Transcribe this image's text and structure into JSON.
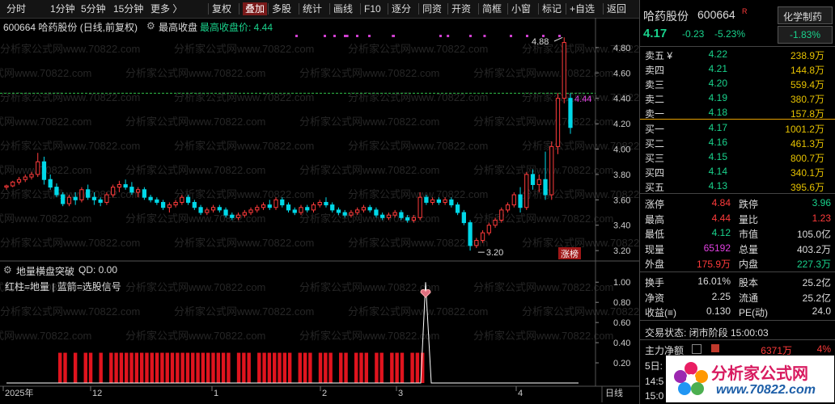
{
  "toolbar": {
    "items": [
      "分时",
      "1分钟",
      "5分钟",
      "15分钟",
      "更多 〉",
      "复权",
      "叠加",
      "多股",
      "统计",
      "画线",
      "F10",
      "逐分",
      "同资",
      "开资",
      "简框",
      "小窗",
      "标记",
      "+自选",
      "返回"
    ],
    "active_index": 6
  },
  "main_header": {
    "title": "600664 哈药股份 (日线,前复权)",
    "indicator": "最高收盘",
    "indicator_value_label": "最高收盘价: 4.44"
  },
  "sub_header": {
    "title": "地量横盘突破",
    "qd": "QD: 0.00",
    "legend": "红柱=地量 | 蓝箭=选股信号"
  },
  "watermark": "分析家公式网www.70822.com",
  "price_axis": [
    "4.80",
    "4.60",
    "4.40",
    "4.20",
    "4.00",
    "3.80",
    "3.60",
    "3.40",
    "3.20"
  ],
  "sub_axis": [
    "1.00",
    "0.80",
    "0.60",
    "0.40",
    "0.20"
  ],
  "x_axis": [
    "2025年",
    "12",
    "1",
    "2",
    "3",
    "4",
    "日线"
  ],
  "annotations": {
    "high": "4.88",
    "low": "3.20",
    "ref": "4.44",
    "badge": "涨榜"
  },
  "stock": {
    "name": "哈药股份",
    "code": "600664",
    "tag": "R",
    "sector": "化学制药",
    "price": "4.17",
    "change": "-0.23",
    "change_pct": "-5.23%",
    "sector_pct": "-1.83%"
  },
  "order_book": {
    "asks": [
      {
        "label": "卖五 ¥",
        "price": "4.22",
        "vol": "238.9万"
      },
      {
        "label": "卖四",
        "price": "4.21",
        "vol": "144.8万"
      },
      {
        "label": "卖三",
        "price": "4.20",
        "vol": "559.4万"
      },
      {
        "label": "卖二",
        "price": "4.19",
        "vol": "380.7万"
      },
      {
        "label": "卖一",
        "price": "4.18",
        "vol": "157.8万"
      }
    ],
    "bids": [
      {
        "label": "买一",
        "price": "4.17",
        "vol": "1001.2万"
      },
      {
        "label": "买二",
        "price": "4.16",
        "vol": "461.3万"
      },
      {
        "label": "买三",
        "price": "4.15",
        "vol": "800.7万"
      },
      {
        "label": "买四",
        "price": "4.14",
        "vol": "340.1万"
      },
      {
        "label": "买五",
        "price": "4.13",
        "vol": "395.6万"
      }
    ]
  },
  "stats1": [
    {
      "l": "涨停",
      "lv": "4.84",
      "lc": "red",
      "r": "跌停",
      "rv": "3.96",
      "rc": "green"
    },
    {
      "l": "最高",
      "lv": "4.44",
      "lc": "red",
      "r": "量比",
      "rv": "1.23",
      "rc": "red"
    },
    {
      "l": "最低",
      "lv": "4.12",
      "lc": "green",
      "r": "市值",
      "rv": "105.0亿",
      "rc": "white"
    },
    {
      "l": "现量",
      "lv": "65192",
      "lc": "magenta",
      "r": "总量",
      "rv": "403.2万",
      "rc": "white"
    },
    {
      "l": "外盘",
      "lv": "175.9万",
      "lc": "red",
      "r": "内盘",
      "rv": "227.3万",
      "rc": "green"
    }
  ],
  "stats2": [
    {
      "l": "换手",
      "lv": "16.01%",
      "r": "股本",
      "rv": "25.2亿"
    },
    {
      "l": "净资",
      "lv": "2.25",
      "r": "流通",
      "rv": "25.2亿"
    },
    {
      "l": "收益(≡)",
      "lv": "0.130",
      "r": "PE(动)",
      "rv": "24.0"
    }
  ],
  "trade_status": "交易状态: 闭市阶段 15:00:03",
  "main_flow": {
    "label": "主力净额",
    "value": "6371万",
    "pct": "4%"
  },
  "bottom_rows": [
    "5日:",
    "14:5",
    "15:0"
  ],
  "logo": {
    "text": "分析家公式网",
    "url": "www.70822.com"
  },
  "colors": {
    "up": "#ff3b3b",
    "down": "#00d8e8",
    "grid": "#3a3a3a",
    "accent": "#e6c200"
  },
  "chart_data": [
    {
      "type": "candlestick",
      "title": "600664 哈药股份 (日线,前复权)",
      "x_labels": [
        "2025年",
        "12",
        "1",
        "2",
        "3",
        "4"
      ],
      "ylim": [
        3.15,
        4.92
      ],
      "reference_line": {
        "name": "最高收盘价",
        "value": 4.44
      },
      "candles": [
        [
          3.7,
          3.72,
          3.68,
          3.71
        ],
        [
          3.71,
          3.75,
          3.7,
          3.74
        ],
        [
          3.74,
          3.78,
          3.72,
          3.76
        ],
        [
          3.76,
          3.8,
          3.74,
          3.78
        ],
        [
          3.78,
          3.82,
          3.76,
          3.8
        ],
        [
          3.8,
          3.97,
          3.78,
          3.9
        ],
        [
          3.9,
          3.94,
          3.72,
          3.76
        ],
        [
          3.76,
          3.8,
          3.68,
          3.7
        ],
        [
          3.7,
          3.73,
          3.62,
          3.64
        ],
        [
          3.64,
          3.66,
          3.55,
          3.57
        ],
        [
          3.57,
          3.64,
          3.55,
          3.62
        ],
        [
          3.62,
          3.66,
          3.56,
          3.6
        ],
        [
          3.6,
          3.7,
          3.58,
          3.68
        ],
        [
          3.68,
          3.72,
          3.6,
          3.62
        ],
        [
          3.62,
          3.66,
          3.56,
          3.6
        ],
        [
          3.6,
          3.62,
          3.55,
          3.58
        ],
        [
          3.58,
          3.66,
          3.56,
          3.64
        ],
        [
          3.64,
          3.72,
          3.62,
          3.7
        ],
        [
          3.7,
          3.75,
          3.66,
          3.72
        ],
        [
          3.72,
          3.76,
          3.68,
          3.7
        ],
        [
          3.7,
          3.74,
          3.64,
          3.66
        ],
        [
          3.66,
          3.7,
          3.62,
          3.68
        ],
        [
          3.68,
          3.7,
          3.6,
          3.62
        ],
        [
          3.62,
          3.64,
          3.58,
          3.6
        ],
        [
          3.6,
          3.62,
          3.56,
          3.58
        ],
        [
          3.58,
          3.6,
          3.52,
          3.54
        ],
        [
          3.54,
          3.58,
          3.5,
          3.56
        ],
        [
          3.56,
          3.6,
          3.54,
          3.58
        ],
        [
          3.58,
          3.64,
          3.56,
          3.62
        ],
        [
          3.62,
          3.64,
          3.56,
          3.58
        ],
        [
          3.58,
          3.6,
          3.52,
          3.54
        ],
        [
          3.54,
          3.56,
          3.48,
          3.5
        ],
        [
          3.5,
          3.54,
          3.48,
          3.52
        ],
        [
          3.52,
          3.56,
          3.5,
          3.54
        ],
        [
          3.54,
          3.56,
          3.5,
          3.52
        ],
        [
          3.52,
          3.54,
          3.46,
          3.48
        ],
        [
          3.48,
          3.5,
          3.44,
          3.46
        ],
        [
          3.46,
          3.5,
          3.44,
          3.48
        ],
        [
          3.48,
          3.52,
          3.46,
          3.5
        ],
        [
          3.5,
          3.54,
          3.48,
          3.52
        ],
        [
          3.52,
          3.56,
          3.5,
          3.54
        ],
        [
          3.54,
          3.58,
          3.52,
          3.56
        ],
        [
          3.56,
          3.6,
          3.52,
          3.54
        ],
        [
          3.54,
          3.62,
          3.52,
          3.6
        ],
        [
          3.6,
          3.62,
          3.54,
          3.56
        ],
        [
          3.56,
          3.58,
          3.5,
          3.52
        ],
        [
          3.52,
          3.54,
          3.48,
          3.5
        ],
        [
          3.5,
          3.56,
          3.48,
          3.54
        ],
        [
          3.54,
          3.56,
          3.5,
          3.52
        ],
        [
          3.52,
          3.58,
          3.5,
          3.56
        ],
        [
          3.56,
          3.6,
          3.54,
          3.58
        ],
        [
          3.58,
          3.62,
          3.54,
          3.56
        ],
        [
          3.56,
          3.58,
          3.5,
          3.52
        ],
        [
          3.52,
          3.54,
          3.48,
          3.5
        ],
        [
          3.5,
          3.52,
          3.46,
          3.48
        ],
        [
          3.48,
          3.52,
          3.46,
          3.5
        ],
        [
          3.5,
          3.54,
          3.48,
          3.52
        ],
        [
          3.52,
          3.56,
          3.5,
          3.54
        ],
        [
          3.54,
          3.56,
          3.5,
          3.52
        ],
        [
          3.52,
          3.54,
          3.46,
          3.48
        ],
        [
          3.48,
          3.5,
          3.44,
          3.46
        ],
        [
          3.46,
          3.5,
          3.44,
          3.48
        ],
        [
          3.48,
          3.52,
          3.46,
          3.5
        ],
        [
          3.5,
          3.52,
          3.44,
          3.46
        ],
        [
          3.46,
          3.48,
          3.42,
          3.44
        ],
        [
          3.44,
          3.48,
          3.42,
          3.46
        ],
        [
          3.46,
          3.66,
          3.44,
          3.62
        ],
        [
          3.62,
          3.64,
          3.56,
          3.58
        ],
        [
          3.58,
          3.62,
          3.56,
          3.6
        ],
        [
          3.6,
          3.62,
          3.56,
          3.58
        ],
        [
          3.58,
          3.62,
          3.56,
          3.6
        ],
        [
          3.6,
          3.62,
          3.54,
          3.56
        ],
        [
          3.56,
          3.58,
          3.48,
          3.5
        ],
        [
          3.5,
          3.52,
          3.4,
          3.42
        ],
        [
          3.42,
          3.44,
          3.2,
          3.24
        ],
        [
          3.24,
          3.3,
          3.22,
          3.28
        ],
        [
          3.28,
          3.36,
          3.26,
          3.34
        ],
        [
          3.34,
          3.42,
          3.32,
          3.4
        ],
        [
          3.4,
          3.46,
          3.38,
          3.44
        ],
        [
          3.44,
          3.54,
          3.42,
          3.52
        ],
        [
          3.52,
          3.58,
          3.5,
          3.56
        ],
        [
          3.56,
          3.66,
          3.54,
          3.64
        ],
        [
          3.64,
          3.7,
          3.5,
          3.54
        ],
        [
          3.54,
          3.82,
          3.52,
          3.8
        ],
        [
          3.8,
          3.84,
          3.68,
          3.72
        ],
        [
          3.72,
          3.8,
          3.66,
          3.76
        ],
        [
          3.76,
          3.98,
          3.6,
          3.64
        ],
        [
          3.64,
          4.06,
          3.6,
          4.02
        ],
        [
          4.02,
          4.44,
          3.96,
          4.4
        ],
        [
          4.4,
          4.88,
          4.36,
          4.84
        ],
        [
          4.4,
          4.44,
          4.12,
          4.17
        ]
      ]
    },
    {
      "type": "bar",
      "title": "地量横盘突破",
      "ylim": [
        0,
        1.05
      ],
      "signal_bars": [
        0,
        1,
        3,
        5,
        6,
        8,
        10,
        11,
        12,
        13,
        14,
        15,
        16,
        17,
        18,
        19,
        20,
        21,
        22,
        23,
        24,
        25,
        26,
        27,
        28,
        29,
        30,
        31,
        32,
        33,
        35,
        36,
        37,
        39,
        40,
        41,
        42,
        43,
        44,
        45,
        47,
        48,
        49,
        51,
        52,
        53,
        55,
        56,
        58,
        59,
        60,
        62,
        63,
        65,
        66,
        67,
        69,
        70,
        71
      ],
      "signal_line_peak": 1.0
    }
  ]
}
